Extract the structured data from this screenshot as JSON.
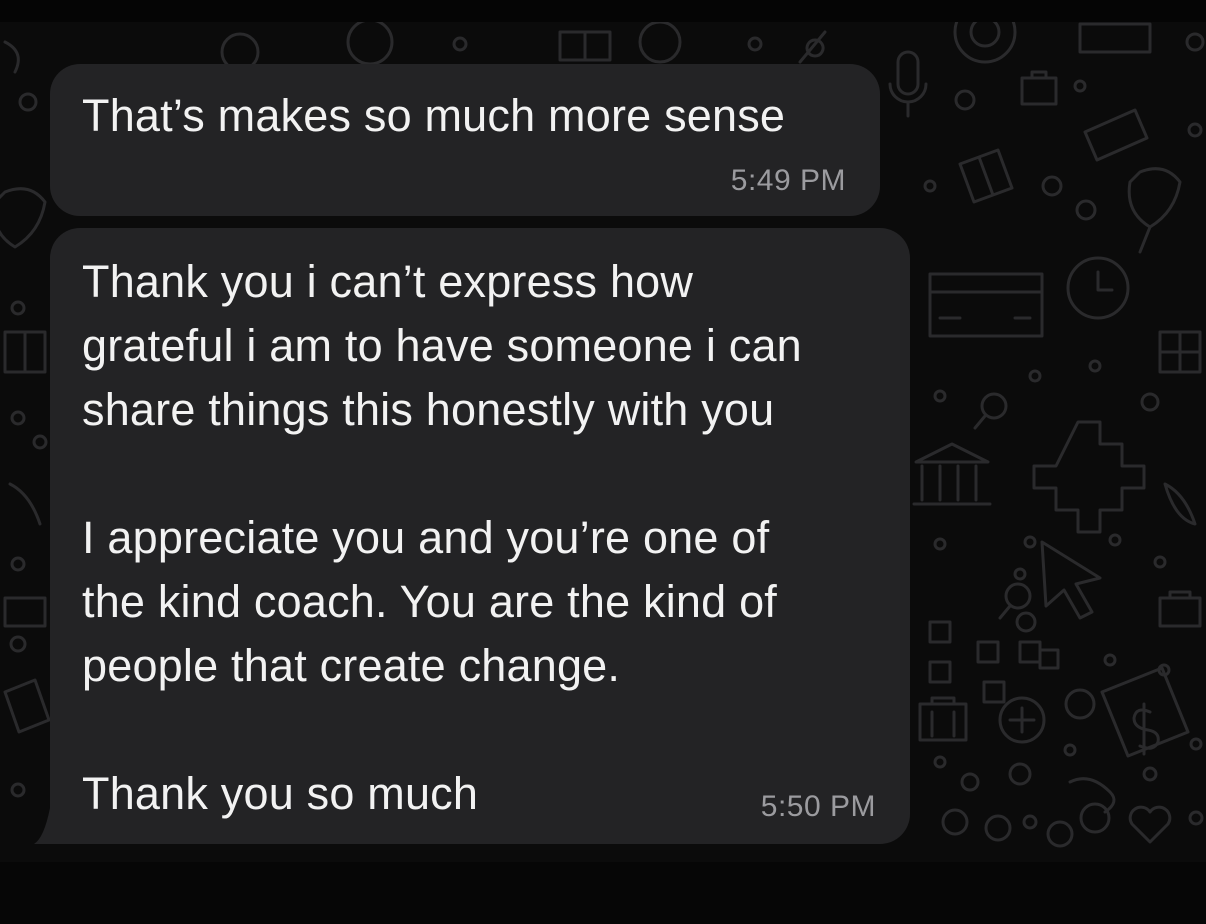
{
  "messages": [
    {
      "text": "That’s makes so much more sense",
      "time": "5:49 PM"
    },
    {
      "text": "Thank you i can’t express how\ngrateful i am to have someone i can\nshare things this honestly with you\n\nI appreciate you and you’re one of\nthe kind coach. You are the kind of\npeople that create change.\n\nThank you so much",
      "time": "5:50 PM"
    }
  ],
  "colors": {
    "background": "#0b0b0b",
    "bubble": "#232325",
    "text": "#f2f2f2",
    "timestamp": "#9b9b9f",
    "wallpaper_doodle": "#2a2a2c"
  },
  "wallpaper": {
    "icons": [
      "gift-icon",
      "microphone-icon",
      "credit-card-icon",
      "clock-icon",
      "bank-icon",
      "magnifier-icon",
      "puzzle-icon",
      "cursor-arrow-icon",
      "plus-icon",
      "dollar-tag-icon",
      "heart-icon",
      "briefcase-icon",
      "flower-icon",
      "camera-icon",
      "circle-doodle"
    ]
  }
}
